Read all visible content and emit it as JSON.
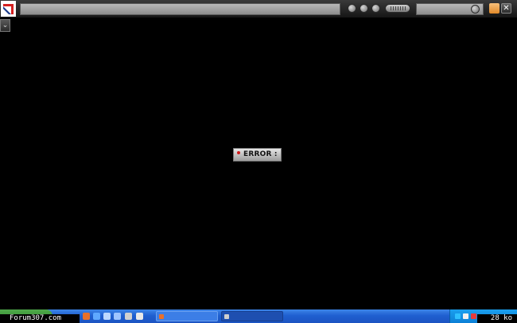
{
  "toolbar": {
    "icons": [
      "logo-icon",
      "back-icon",
      "home-icon",
      "refresh-icon",
      "volume-icon",
      "search-icon",
      "minimize-icon",
      "close-icon"
    ],
    "minimize_glyph": "",
    "close_glyph": "✕",
    "side_toggle_glyph": "⌄"
  },
  "error": {
    "label": "ERROR :",
    "color": "#d01a1a"
  },
  "status": {
    "site": "Forum307.com",
    "size": "28 ko"
  },
  "colors": {
    "taskbar": "#1f5fd0",
    "start": "#2f8a2a",
    "background": "#000000"
  }
}
